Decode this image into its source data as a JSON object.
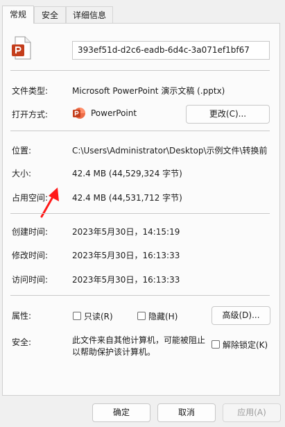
{
  "tabs": [
    {
      "label": "常规",
      "active": true
    },
    {
      "label": "安全",
      "active": false
    },
    {
      "label": "详细信息",
      "active": false
    }
  ],
  "file_name": "393ef51d-d2c6-eadb-6d4c-3a071ef1bf67",
  "file_type": {
    "label": "文件类型:",
    "value": "Microsoft PowerPoint 演示文稿 (.pptx)"
  },
  "open_with": {
    "label": "打开方式:",
    "app": "PowerPoint",
    "change_button": "更改(C)..."
  },
  "location": {
    "label": "位置:",
    "value": "C:\\Users\\Administrator\\Desktop\\示例文件\\转换前"
  },
  "size": {
    "label": "大小:",
    "value": "42.4 MB (44,529,324 字节)"
  },
  "size_on_disk": {
    "label": "占用空间:",
    "value": "42.4 MB (44,531,712 字节)"
  },
  "created": {
    "label": "创建时间:",
    "value": "2023年5月30日，14:15:19"
  },
  "modified": {
    "label": "修改时间:",
    "value": "2023年5月30日，16:13:33"
  },
  "accessed": {
    "label": "访问时间:",
    "value": "2023年5月30日，16:13:33"
  },
  "attributes": {
    "label": "属性:",
    "readonly": "只读(R)",
    "hidden": "隐藏(H)",
    "advanced_button": "高级(D)..."
  },
  "security": {
    "label": "安全:",
    "message": "此文件来自其他计算机，可能被阻止以帮助保护该计算机。",
    "unblock": "解除锁定(K)"
  },
  "footer": {
    "ok": "确定",
    "cancel": "取消",
    "apply": "应用(A)"
  },
  "colors": {
    "accent": "#c43e1c",
    "arrow": "#ff1a1a"
  },
  "icons": {
    "file": "powerpoint-file-icon",
    "app": "powerpoint-app-icon",
    "annotation": "red-arrow-annotation"
  }
}
